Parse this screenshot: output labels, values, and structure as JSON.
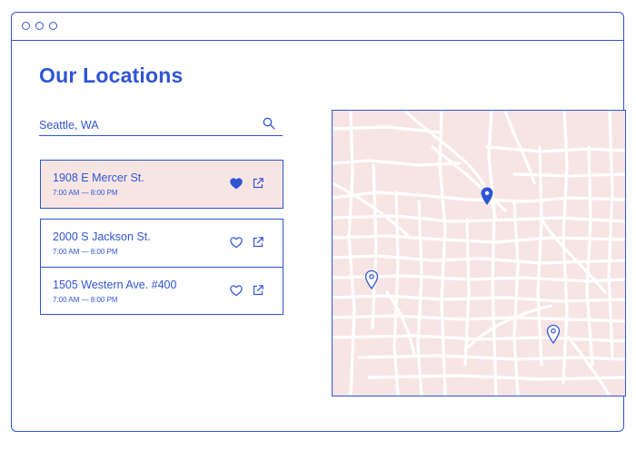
{
  "page": {
    "title": "Our Locations"
  },
  "search": {
    "value": "Seattle, WA",
    "icon": "search-icon"
  },
  "locations": [
    {
      "address": "1908 E Mercer St.",
      "hours": "7:00 AM — 8:00 PM",
      "favorited": true,
      "selected": true
    },
    {
      "address": "2000 S Jackson St.",
      "hours": "7:00 AM — 8:00 PM",
      "favorited": false,
      "selected": false
    },
    {
      "address": "1505 Western Ave. #400",
      "hours": "7:00 AM — 8:00 PM",
      "favorited": false,
      "selected": false
    }
  ],
  "map": {
    "pins": [
      "selected-location",
      "location",
      "location"
    ]
  },
  "colors": {
    "accent": "#2f55d4",
    "map_bg": "#f7e5e4",
    "selected_bg": "#f7e5e4",
    "roads": "#ffffff"
  }
}
